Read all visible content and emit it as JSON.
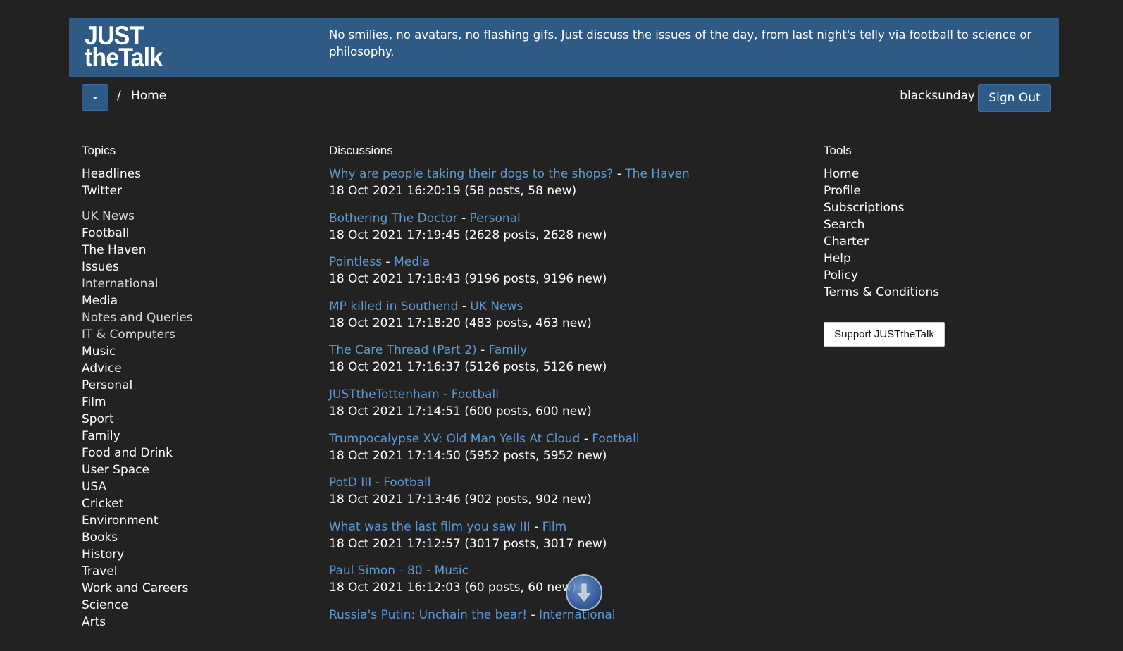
{
  "header": {
    "logo_line1": "JUST",
    "logo_line2": "theTalk",
    "tagline": "No smilies, no avatars, no flashing gifs. Just discuss the issues of the day, from last night's telly via football to science or philosophy."
  },
  "nav": {
    "separator": "/",
    "breadcrumb_home": "Home",
    "username": "blacksunday",
    "sign_out": "Sign Out"
  },
  "topics": {
    "heading": "Topics",
    "pinned": [
      "Headlines",
      "Twitter"
    ],
    "items": [
      "UK News",
      "Football",
      "The Haven",
      "Issues",
      "International",
      "Media",
      "Notes and Queries",
      "IT & Computers",
      "Music",
      "Advice",
      "Personal",
      "Film",
      "Sport",
      "Family",
      "Food and Drink",
      "User Space",
      "USA",
      "Cricket",
      "Environment",
      "Books",
      "History",
      "Travel",
      "Work and Careers",
      "Science",
      "Arts"
    ]
  },
  "discussions": {
    "heading": "Discussions",
    "separator": "-",
    "items": [
      {
        "title": "Why are people taking their dogs to the shops?",
        "topic": "The Haven",
        "meta": "18 Oct 2021 16:20:19 (58 posts, 58 new)"
      },
      {
        "title": "Bothering The Doctor",
        "topic": "Personal",
        "meta": "18 Oct 2021 17:19:45 (2628 posts, 2628 new)"
      },
      {
        "title": "Pointless",
        "topic": "Media",
        "meta": "18 Oct 2021 17:18:43 (9196 posts, 9196 new)"
      },
      {
        "title": "MP killed in Southend",
        "topic": "UK News",
        "meta": "18 Oct 2021 17:18:20 (483 posts, 463 new)"
      },
      {
        "title": "The Care Thread (Part 2)",
        "topic": "Family",
        "meta": "18 Oct 2021 17:16:37 (5126 posts, 5126 new)"
      },
      {
        "title": "JUSTtheTottenham",
        "topic": "Football",
        "meta": "18 Oct 2021 17:14:51 (600 posts, 600 new)"
      },
      {
        "title": "Trumpocalypse XV: Old Man Yells At Cloud",
        "topic": "Football",
        "meta": "18 Oct 2021 17:14:50 (5952 posts, 5952 new)"
      },
      {
        "title": "PotD III",
        "topic": "Football",
        "meta": "18 Oct 2021 17:13:46 (902 posts, 902 new)"
      },
      {
        "title": "What was the last film you saw III",
        "topic": "Film",
        "meta": "18 Oct 2021 17:12:57 (3017 posts, 3017 new)"
      },
      {
        "title": "Paul Simon - 80",
        "topic": "Music",
        "meta": "18 Oct 2021 16:12:03 (60 posts, 60 new)"
      },
      {
        "title": "Russia's Putin: Unchain the bear!",
        "topic": "International",
        "meta": ""
      }
    ]
  },
  "tools": {
    "heading": "Tools",
    "items": [
      "Home",
      "Profile",
      "Subscriptions",
      "Search",
      "Charter",
      "Help",
      "Policy",
      "Terms & Conditions"
    ],
    "support_button": "Support JUSTtheTalk"
  },
  "colors": {
    "background": "#222222",
    "banner": "#2e5a85",
    "link": "#5b9ad8",
    "text": "#ffffff"
  },
  "icons": {
    "menu": "caret-down-icon",
    "scroll": "arrow-down-circle-icon"
  }
}
